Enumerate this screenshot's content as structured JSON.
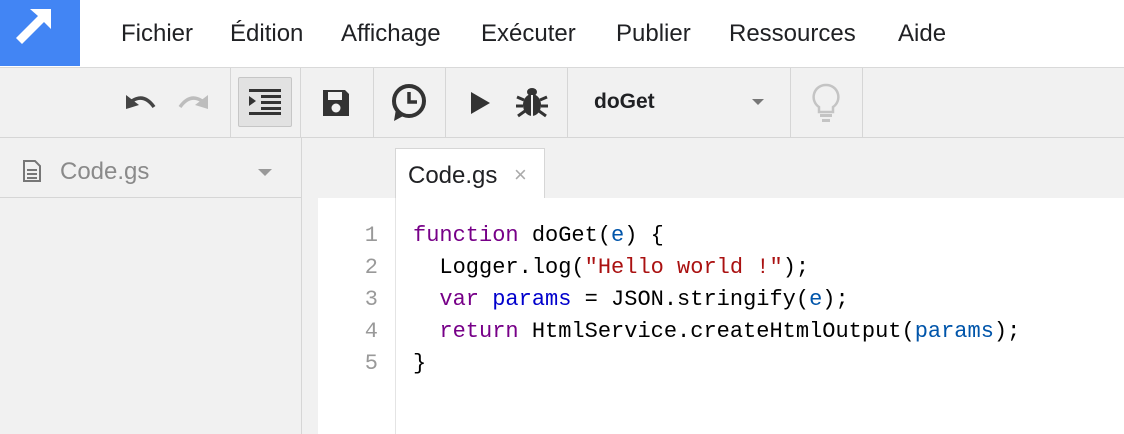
{
  "colors": {
    "brand": "#4285f4",
    "toolbar_bg": "#f1f1f1",
    "keyword": "#770088",
    "string": "#aa1111",
    "variable": "#0055aa"
  },
  "menu": {
    "items": [
      "Fichier",
      "Édition",
      "Affichage",
      "Exécuter",
      "Publier",
      "Ressources",
      "Aide"
    ]
  },
  "toolbar": {
    "icons": [
      "undo-icon",
      "redo-icon",
      "indent-icon",
      "save-icon",
      "triggers-clock-icon",
      "run-icon",
      "debug-bug-icon",
      "lightbulb-icon"
    ],
    "function_select": {
      "value": "doGet"
    }
  },
  "sidebar": {
    "files": [
      {
        "name": "Code.gs",
        "icon": "document-icon"
      }
    ]
  },
  "editor": {
    "tab": {
      "label": "Code.gs",
      "close": "×"
    },
    "lines": [
      {
        "number": "1",
        "tokens": [
          {
            "t": "function",
            "c": "kw"
          },
          {
            "t": " doGet(",
            "c": ""
          },
          {
            "t": "e",
            "c": "var"
          },
          {
            "t": ") {",
            "c": ""
          }
        ]
      },
      {
        "number": "2",
        "tokens": [
          {
            "t": "  Logger.log(",
            "c": ""
          },
          {
            "t": "\"Hello world !\"",
            "c": "str"
          },
          {
            "t": ");",
            "c": ""
          }
        ]
      },
      {
        "number": "3",
        "tokens": [
          {
            "t": "  ",
            "c": ""
          },
          {
            "t": "var",
            "c": "kw"
          },
          {
            "t": " ",
            "c": ""
          },
          {
            "t": "params",
            "c": "kw2"
          },
          {
            "t": " = JSON.stringify(",
            "c": ""
          },
          {
            "t": "e",
            "c": "var"
          },
          {
            "t": ");",
            "c": ""
          }
        ]
      },
      {
        "number": "4",
        "tokens": [
          {
            "t": "  ",
            "c": ""
          },
          {
            "t": "return",
            "c": "kw"
          },
          {
            "t": " HtmlService.createHtmlOutput(",
            "c": ""
          },
          {
            "t": "params",
            "c": "var"
          },
          {
            "t": ");",
            "c": ""
          }
        ]
      },
      {
        "number": "5",
        "tokens": [
          {
            "t": "}",
            "c": ""
          }
        ]
      }
    ]
  }
}
